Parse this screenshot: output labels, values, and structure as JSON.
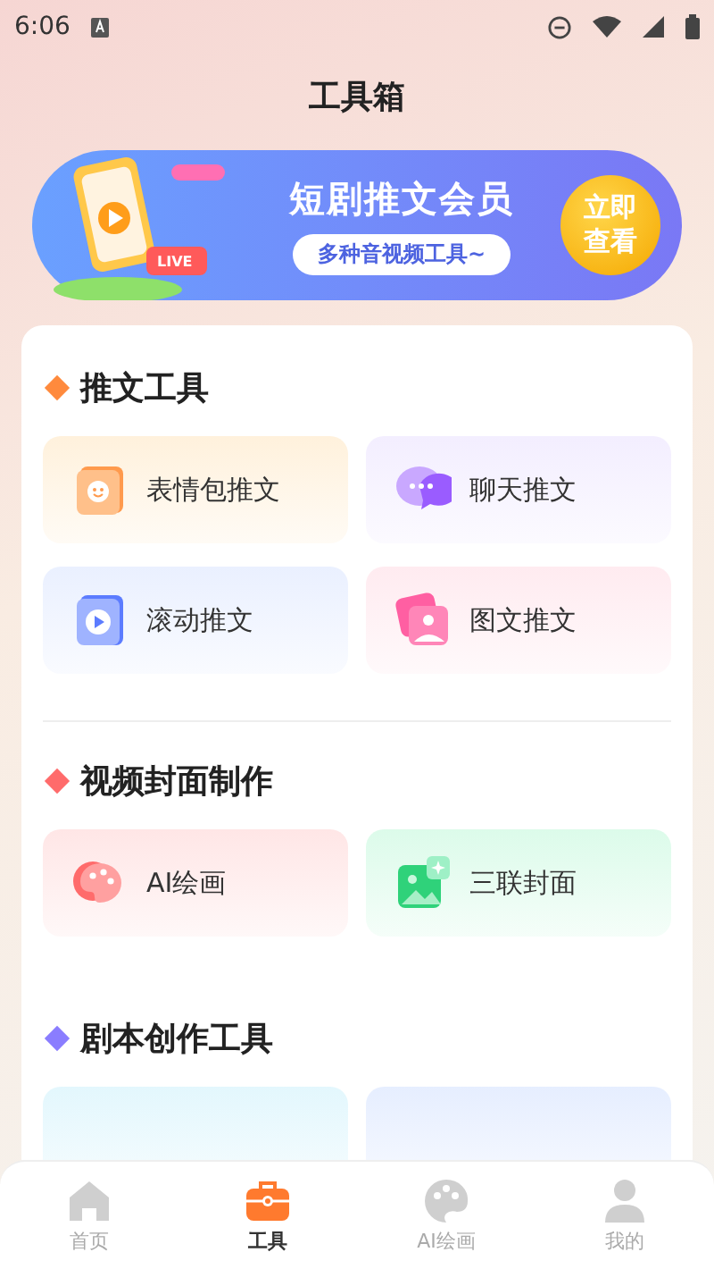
{
  "status_bar": {
    "time": "6:06"
  },
  "title": "工具箱",
  "banner": {
    "title": "短剧推文会员",
    "subtitle": "多种音视频工具~",
    "button": "立即查看",
    "tag": "LIVE"
  },
  "sections": [
    {
      "title": "推文工具",
      "color": "#ff8a3d",
      "divider": true,
      "tiles": [
        {
          "label": "表情包推文",
          "kind": "emoji",
          "color": "#fff1dc"
        },
        {
          "label": "聊天推文",
          "kind": "chat",
          "color": "#f3eeff"
        },
        {
          "label": "滚动推文",
          "kind": "video",
          "color": "#eaf0ff"
        },
        {
          "label": "图文推文",
          "kind": "photo",
          "color": "#ffebf0"
        }
      ]
    },
    {
      "title": "视频封面制作",
      "color": "#ff6b6b",
      "divider": false,
      "tiles": [
        {
          "label": "AI绘画",
          "kind": "palette",
          "color": "#ffe6e6"
        },
        {
          "label": "三联封面",
          "kind": "image",
          "color": "#dcfbea"
        }
      ]
    },
    {
      "title": "剧本创作工具",
      "color": "#8a7dff",
      "divider": false,
      "tiles": [
        {
          "kind": "none",
          "color": "#e3f7fd"
        },
        {
          "kind": "none",
          "color": "#e6eeff"
        }
      ]
    }
  ],
  "nav": [
    {
      "label": "首页",
      "kind": "home",
      "selected": false
    },
    {
      "label": "工具",
      "kind": "toolbox",
      "selected": true
    },
    {
      "label": "AI绘画",
      "kind": "palette",
      "selected": false
    },
    {
      "label": "我的",
      "kind": "person",
      "selected": false
    }
  ]
}
